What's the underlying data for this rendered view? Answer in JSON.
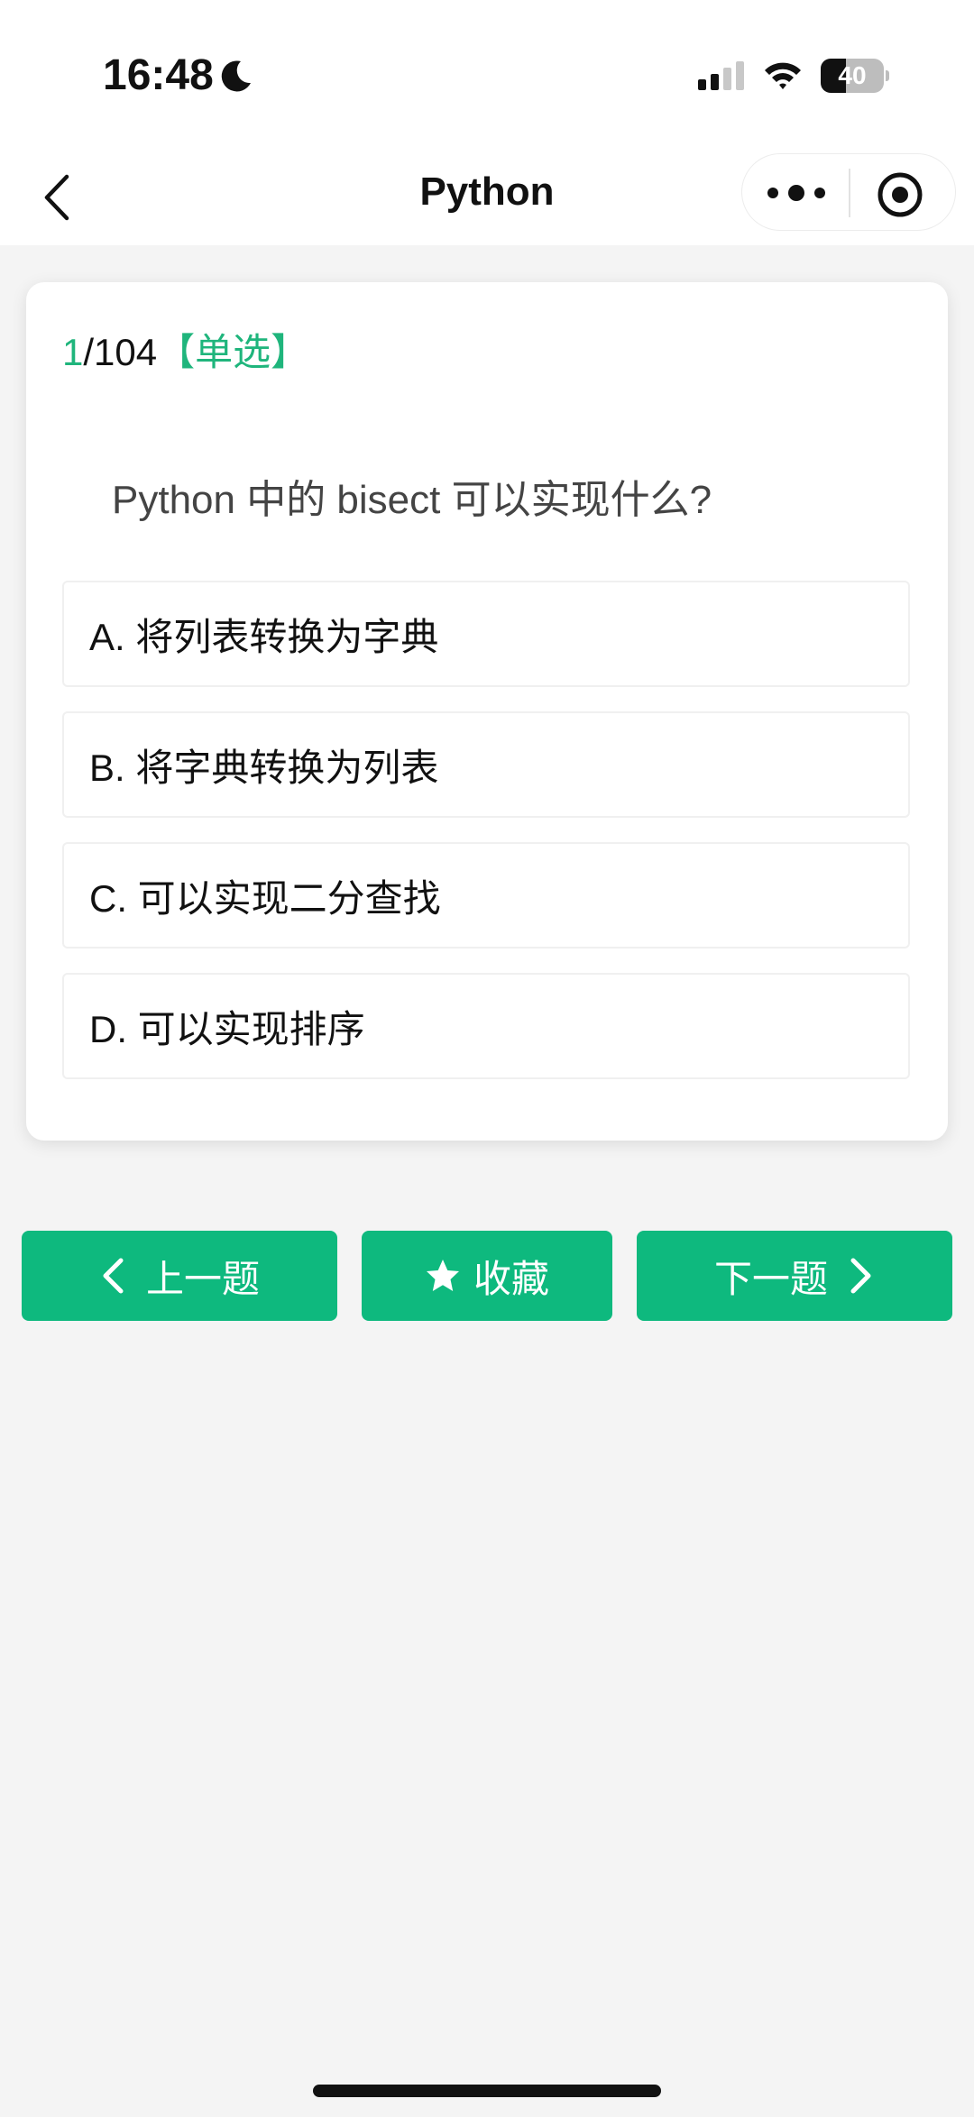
{
  "status_bar": {
    "time": "16:48",
    "battery_level": "40",
    "battery_fraction": 0.4,
    "icons": [
      "moon-icon",
      "signal-icon",
      "wifi-icon",
      "battery-icon"
    ]
  },
  "nav": {
    "title": "Python",
    "icons": [
      "chevron-left-icon",
      "more-dots-icon",
      "target-circle-icon"
    ]
  },
  "quiz": {
    "current": "1",
    "total": "/104",
    "type_label": "【单选】",
    "question": "Python 中的 bisect 可以实现什么?",
    "options": [
      {
        "label": "A. 将列表转换为字典"
      },
      {
        "label": "B. 将字典转换为列表"
      },
      {
        "label": "C. 可以实现二分查找"
      },
      {
        "label": "D. 可以实现排序"
      }
    ]
  },
  "actions": {
    "prev_label": "上一题",
    "favorite_label": "收藏",
    "next_label": "下一题",
    "accent_color": "#0eb97e"
  }
}
